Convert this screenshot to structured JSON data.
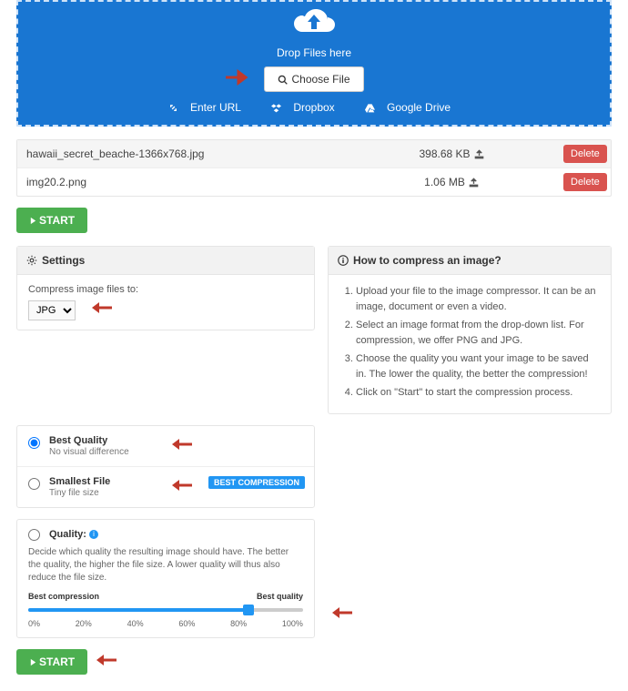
{
  "dropzone": {
    "text": "Drop Files here",
    "choose": "Choose File",
    "sources": {
      "url": "Enter URL",
      "dropbox": "Dropbox",
      "gdrive": "Google Drive"
    }
  },
  "files": [
    {
      "name": "hawaii_secret_beache-1366x768.jpg",
      "size": "398.68 KB"
    },
    {
      "name": "img20.2.png",
      "size": "1.06 MB"
    }
  ],
  "delete_label": "Delete",
  "start_label": "START",
  "settings": {
    "title": "Settings",
    "compress_to_label": "Compress image files to:",
    "format_options": [
      "JPG"
    ],
    "format_selected": "JPG"
  },
  "options": {
    "best_quality": {
      "title": "Best Quality",
      "sub": "No visual difference"
    },
    "smallest": {
      "title": "Smallest File",
      "sub": "Tiny file size",
      "badge": "BEST COMPRESSION"
    }
  },
  "quality": {
    "title": "Quality:",
    "desc": "Decide which quality the resulting image should have. The better the quality, the higher the file size. A lower quality will thus also reduce the file size.",
    "left": "Best compression",
    "right": "Best quality",
    "ticks": [
      "0%",
      "20%",
      "40%",
      "60%",
      "80%",
      "100%"
    ],
    "value": 80
  },
  "help": {
    "title": "How to compress an image?",
    "steps": [
      "Upload your file to the image compressor. It can be an image, document or even a video.",
      "Select an image format from the drop-down list. For compression, we offer PNG and JPG.",
      "Choose the quality you want your image to be saved in. The lower the quality, the better the compression!",
      "Click on \"Start\" to start the compression process."
    ]
  }
}
